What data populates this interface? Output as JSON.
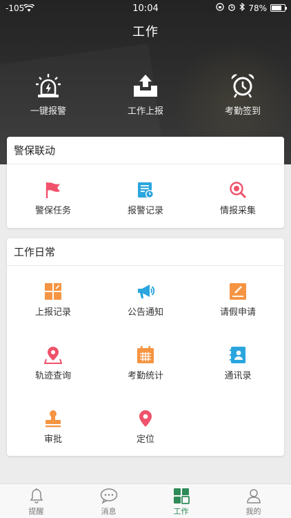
{
  "status_bar": {
    "signal": "-105",
    "time": "10:04",
    "battery": "78%",
    "battery_level": 0.78
  },
  "header": {
    "title": "工作"
  },
  "quick_actions": [
    {
      "label": "一键报警",
      "icon": "alarm-light-icon"
    },
    {
      "label": "工作上报",
      "icon": "upload-tray-icon"
    },
    {
      "label": "考勤签到",
      "icon": "alarm-clock-icon"
    }
  ],
  "security": {
    "title": "警保联动",
    "items": [
      {
        "label": "警保任务",
        "icon": "flag-icon",
        "color": "#f0516b"
      },
      {
        "label": "报警记录",
        "icon": "report-record-icon",
        "color": "#2aa5de"
      },
      {
        "label": "情报采集",
        "icon": "search-icon",
        "color": "#f0516b"
      }
    ]
  },
  "daily": {
    "title": "工作日常",
    "items": [
      {
        "label": "上报记录",
        "icon": "report-grid-icon",
        "color": "#f59442"
      },
      {
        "label": "公告通知",
        "icon": "megaphone-icon",
        "color": "#2aa5de"
      },
      {
        "label": "请假申请",
        "icon": "leave-form-icon",
        "color": "#f59442"
      },
      {
        "label": "轨迹查询",
        "icon": "track-location-icon",
        "color": "#f0516b"
      },
      {
        "label": "考勤统计",
        "icon": "calendar-icon",
        "color": "#f59442"
      },
      {
        "label": "通讯录",
        "icon": "contacts-icon",
        "color": "#2aa5de"
      },
      {
        "label": "审批",
        "icon": "stamp-icon",
        "color": "#f59442"
      },
      {
        "label": "定位",
        "icon": "location-pin-icon",
        "color": "#f0516b"
      }
    ]
  },
  "tabbar": {
    "items": [
      {
        "label": "提醒",
        "icon": "bell-icon"
      },
      {
        "label": "消息",
        "icon": "chat-icon"
      },
      {
        "label": "工作",
        "icon": "work-grid-icon",
        "active": true
      },
      {
        "label": "我的",
        "icon": "profile-icon"
      }
    ],
    "active_color": "#2e8b57"
  }
}
